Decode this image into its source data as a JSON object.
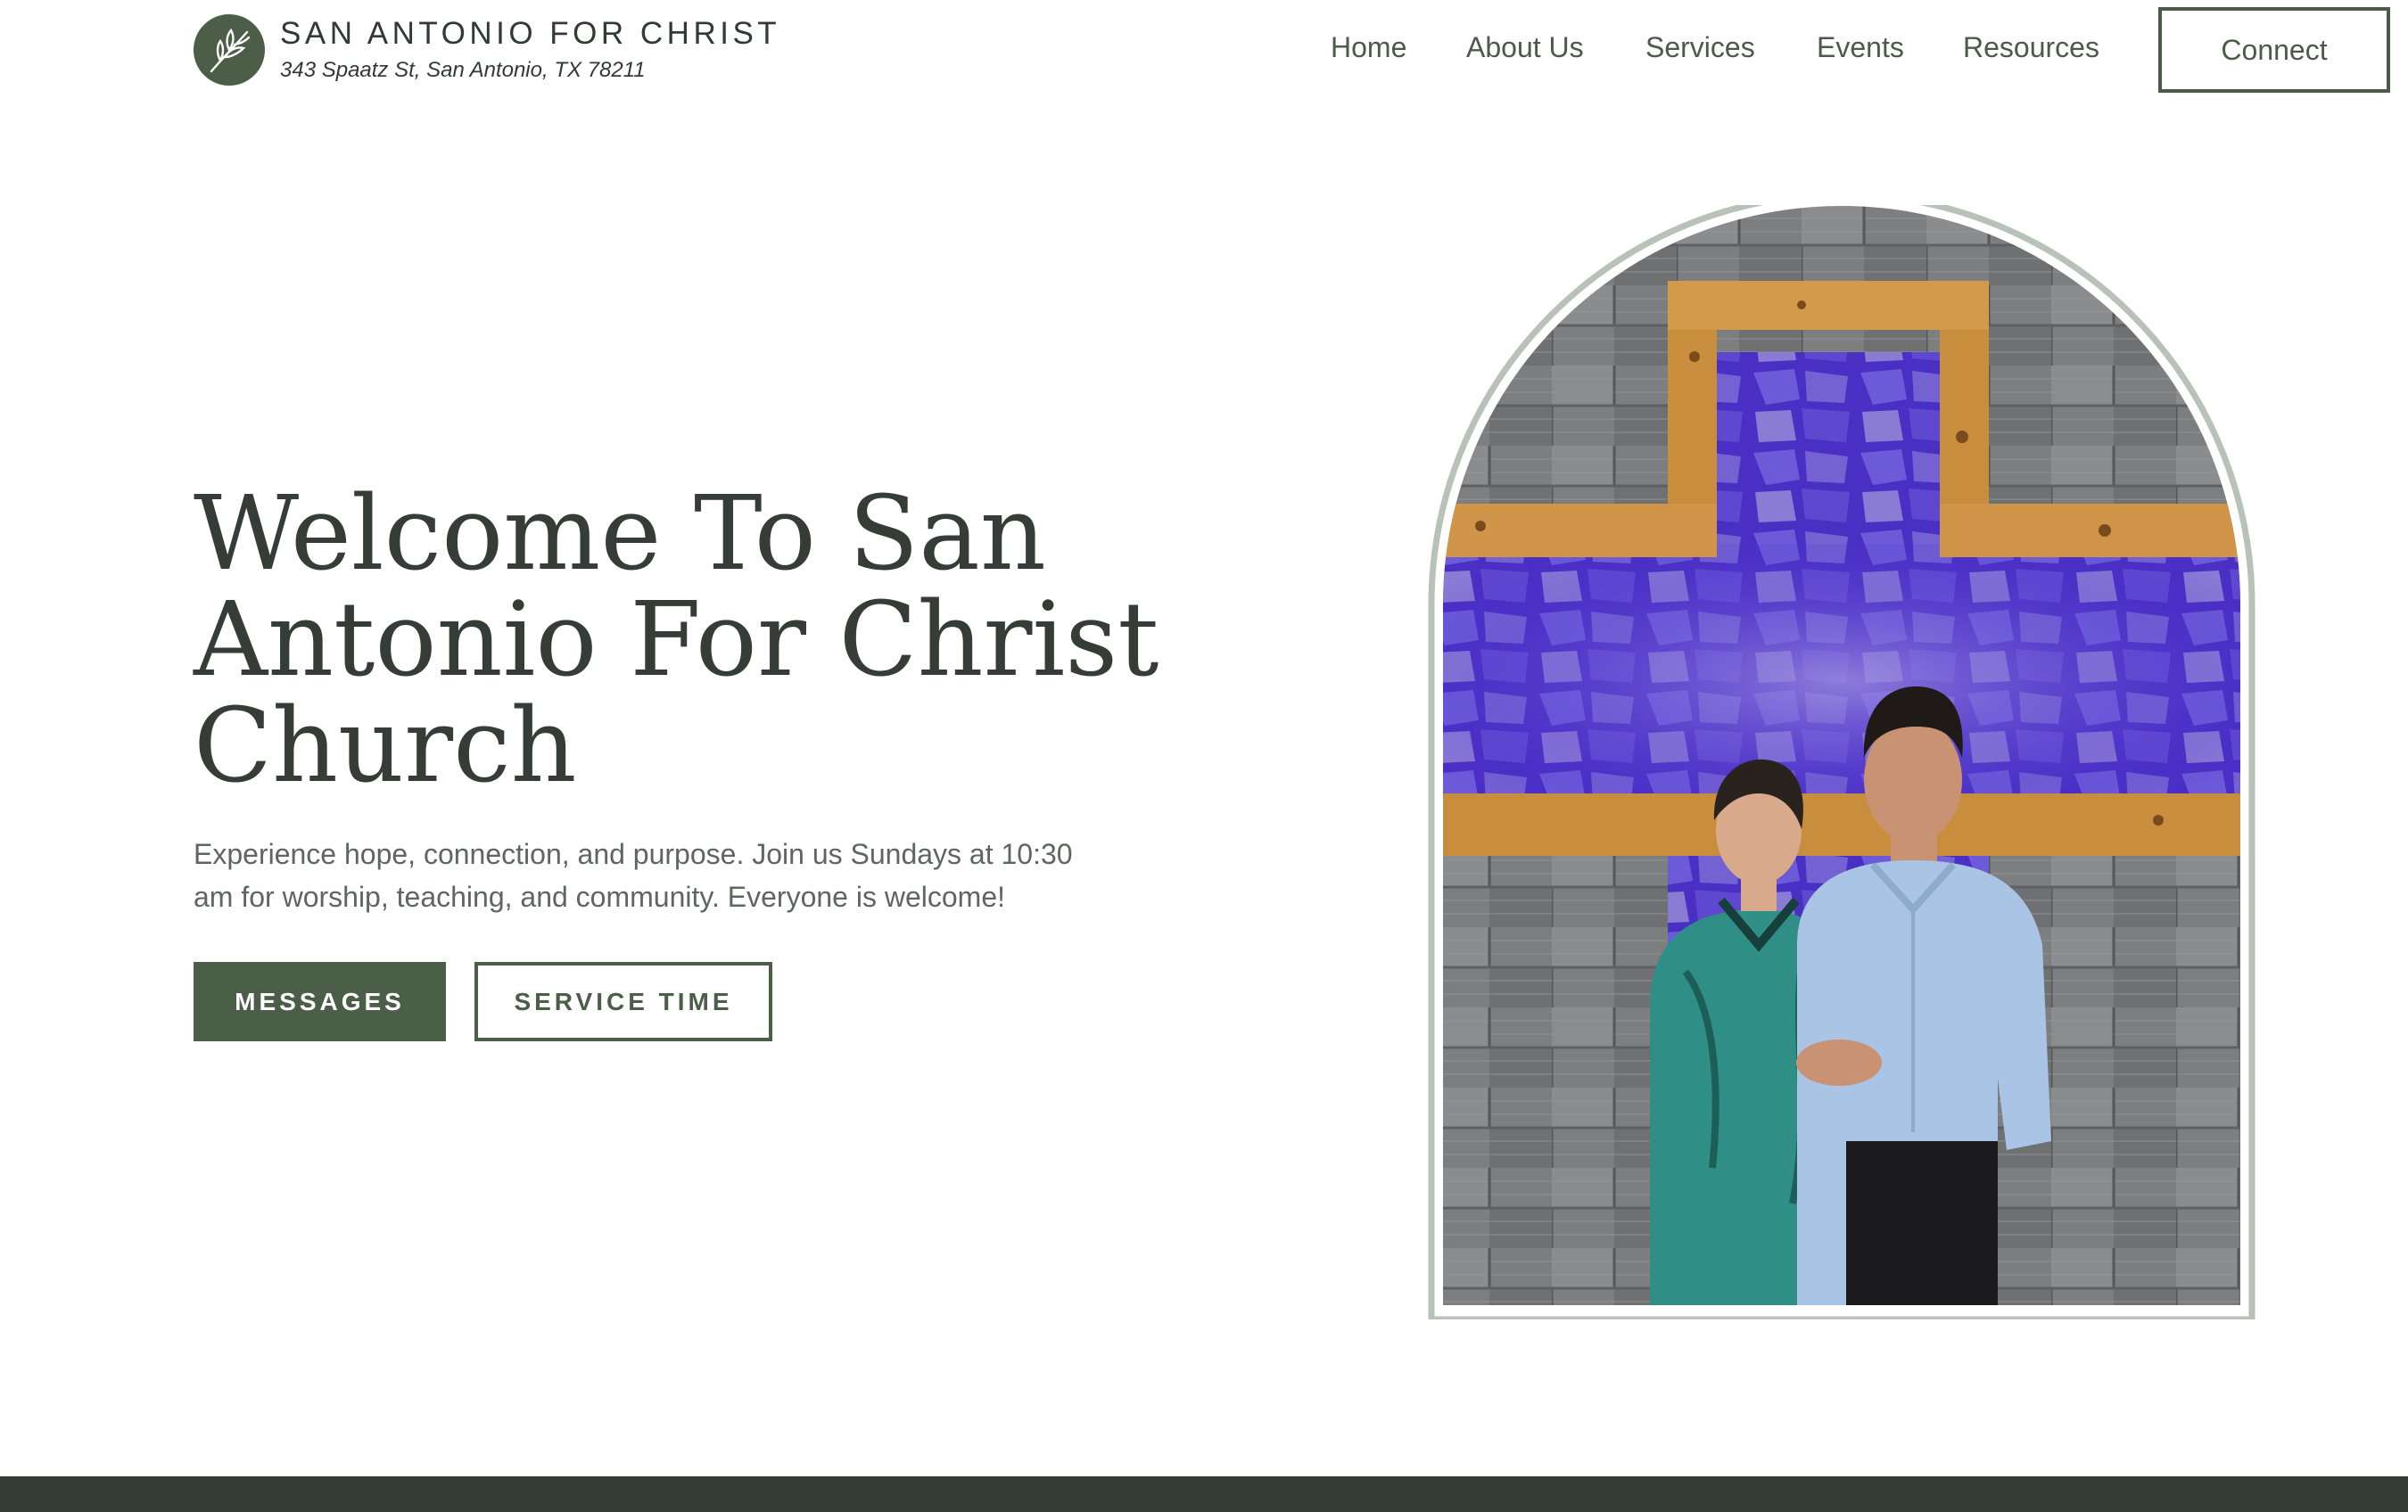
{
  "header": {
    "logo_icon": "leaf-sprig-icon",
    "brand_name": "SAN ANTONIO FOR CHRIST",
    "address": "343 Spaatz St, San Antonio, TX 78211"
  },
  "nav": {
    "items": [
      {
        "label": "Home"
      },
      {
        "label": "About Us"
      },
      {
        "label": "Services"
      },
      {
        "label": "Events"
      },
      {
        "label": "Resources"
      }
    ],
    "connect_label": "Connect"
  },
  "hero": {
    "title": "Welcome To San Antonio For Christ Church",
    "text": "Experience hope, connection, and purpose. Join us Sundays at 10:30 am for worship, teaching, and community. Everyone is welcome!",
    "buttons": {
      "messages": "MESSAGES",
      "service_time": "SERVICE TIME"
    }
  },
  "colors": {
    "brand_green": "#4b5e47",
    "heading": "#353d36",
    "body_text": "#5d6660",
    "footer": "#333d35",
    "arch_border": "#b9c2b8",
    "cross_glow": "#5a3ae0",
    "wood": "#c98d3e"
  }
}
